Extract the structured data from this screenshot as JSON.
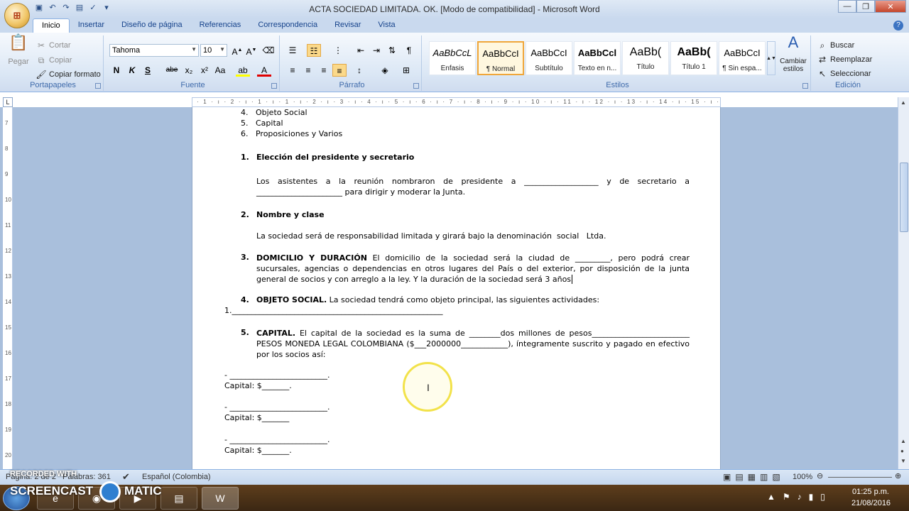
{
  "window": {
    "title": "ACTA SOCIEDAD LIMITADA. OK. [Modo de compatibilidad] - Microsoft Word",
    "minimize": "—",
    "maximize": "❐",
    "close": "✕"
  },
  "tabs": [
    "Inicio",
    "Insertar",
    "Diseño de página",
    "Referencias",
    "Correspondencia",
    "Revisar",
    "Vista"
  ],
  "ribbon": {
    "clipboard": {
      "label": "Portapapeles",
      "paste": "Pegar",
      "cut": "Cortar",
      "copy": "Copiar",
      "format_painter": "Copiar formato"
    },
    "font": {
      "label": "Fuente",
      "font_name": "Tahoma",
      "font_size": "10",
      "bold": "N",
      "italic": "K",
      "underline": "S",
      "strike": "abe",
      "subscript": "x₂",
      "superscript": "x²",
      "case": "Aa"
    },
    "paragraph": {
      "label": "Párrafo"
    },
    "styles": {
      "label": "Estilos",
      "items": [
        {
          "sample": "AaBbCcL",
          "name": "Énfasis"
        },
        {
          "sample": "AaBbCcI",
          "name": "¶ Normal"
        },
        {
          "sample": "AaBbCcI",
          "name": "Subtítulo"
        },
        {
          "sample": "AaBbCcl",
          "name": "Texto en n..."
        },
        {
          "sample": "AaBb(",
          "name": "Título"
        },
        {
          "sample": "AaBb(",
          "name": "Título 1"
        },
        {
          "sample": "AaBbCcI",
          "name": "¶ Sin espa..."
        }
      ],
      "change_styles": "Cambiar estilos"
    },
    "editing": {
      "label": "Edición",
      "find": "Buscar",
      "replace": "Reemplazar",
      "select": "Seleccionar"
    }
  },
  "ruler": "· 1 · ı · 2 · ı · 1 · ı · 1 · ı · 2 · ı · 3 · ı · 4 · ı · 5 · ı · 6 · ı · 7 · ı · 8 · ı · 9 · ı · 10 · ı · 11 · ı · 12 · ı · 13 · ı · 14 · ı · 15 · ı · 16 · ı · 17 · ı · 18 · ı · 19 ·",
  "vruler": [
    "7",
    "8",
    "9",
    "10",
    "11",
    "12",
    "13",
    "14",
    "15",
    "16",
    "17",
    "18",
    "19",
    "20"
  ],
  "document": {
    "list_items": [
      "4.   Objeto Social",
      "5.   Capital",
      "6.   Proposiciones y Varios"
    ],
    "s1_num": "1.",
    "s1_title": "Elección del presidente y secretario",
    "s1_text": "Los asistentes a la reunión nombraron de presidente a ___________________ y de secretario a ______________________ para dirigir y moderar la Junta.",
    "s2_num": "2.",
    "s2_title": "Nombre y clase",
    "s2_text": "La sociedad será de responsabilidad limitada y girará bajo la denominación  social   Ltda.",
    "s3_num": "3.",
    "s3_title": "DOMICILIO Y DURACIÓN",
    "s3_text": " El domicilio de la sociedad será la ciudad de _________, pero podrá crear sucursales, agencias o dependencias en otros lugares del País o del exterior, por disposición de la junta general de socios y con arreglo a la ley. Y la duración de la sociedad será 3 años",
    "s4_num": "4.",
    "s4_title": "OBJETO SOCIAL.",
    "s4_text": " La sociedad tendrá como objeto principal, las siguientes actividades:",
    "s4_item": "1.______________________________________________________",
    "s5_num": "5.",
    "s5_title": "CAPITAL.",
    "s5_text": " El capital de la sociedad es la suma de ________dos millones de pesos_________________________ PESOS MONEDA LEGAL COLOMBIANA ($___2000000____________), íntegramente suscrito y pagado en efectivo por los socios así:",
    "partners": [
      {
        "line": "- _________________________.",
        "capital": "Capital: $_______."
      },
      {
        "line": "- _________________________.",
        "capital": "Capital: $_______"
      },
      {
        "line": "- _________________________.",
        "capital": "Capital: $_______."
      }
    ]
  },
  "status": {
    "page": "Página: 2 de 2",
    "words": "Palabras: 361",
    "language": "Español (Colombia)",
    "zoom": "100%"
  },
  "taskbar": {
    "time": "01:25 p.m.",
    "date": "21/08/2016"
  },
  "watermark": {
    "top": "RECORDED WITH",
    "brand_left": "SCREENCAST",
    "brand_right": "MATIC"
  },
  "colors": {
    "ribbon_bg": "#dbe7f5",
    "workspace": "#a9bfdc",
    "selected_style": "#f0a63a",
    "cursor_highlight": "#f2e24a"
  }
}
